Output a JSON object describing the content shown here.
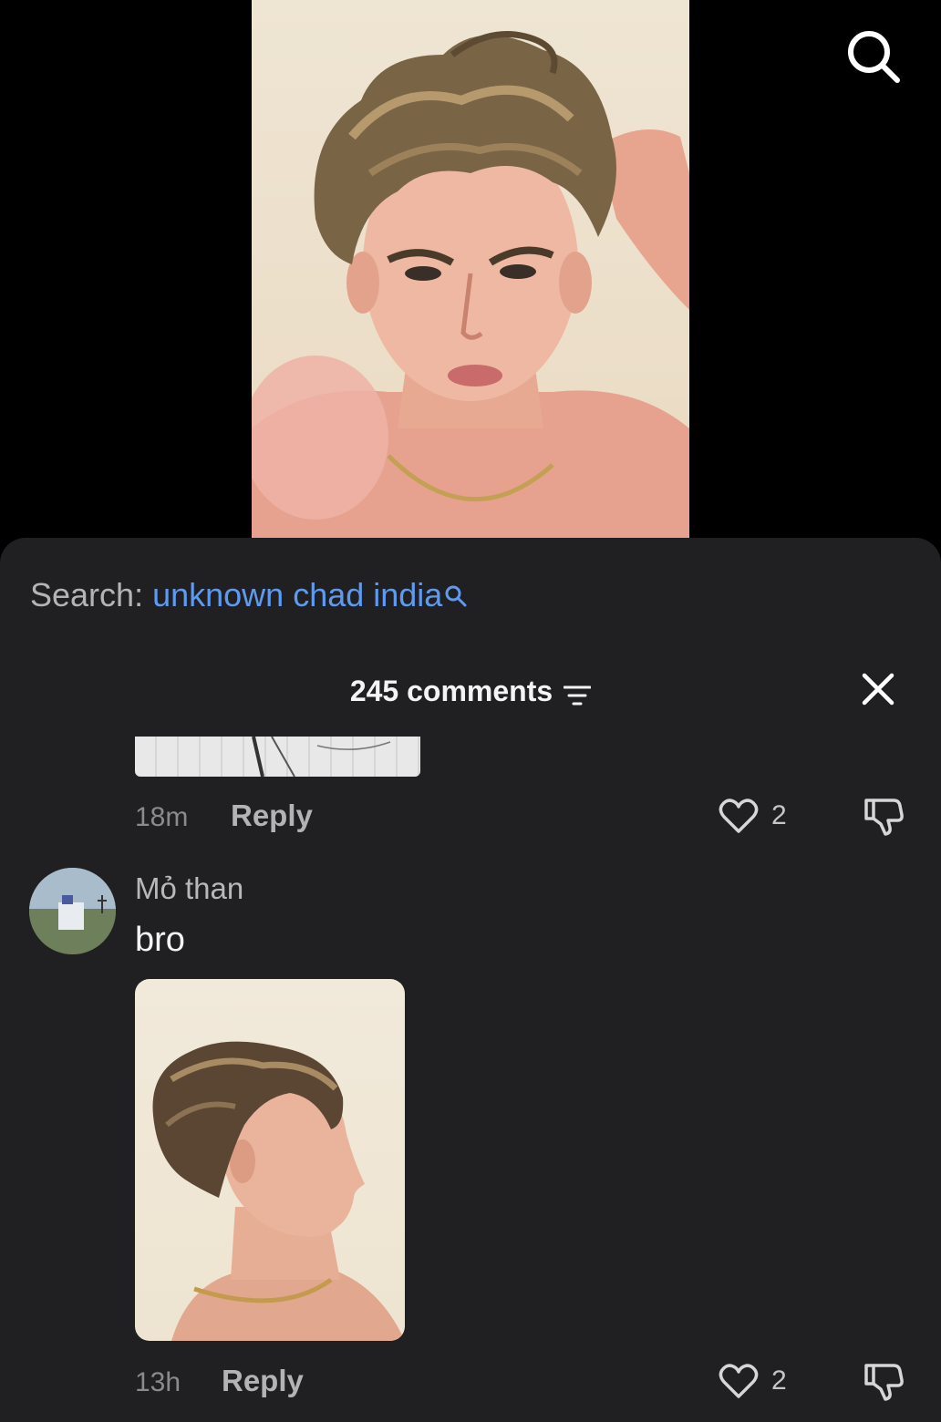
{
  "top_bar": {
    "search_icon": "search-icon"
  },
  "video": {
    "thumbnail_icon": "video-frame"
  },
  "sheet": {
    "search_prefix": "Search:",
    "search_query": "unknown chad india",
    "header": {
      "comments_count_label": "245 comments",
      "sort_icon": "filter-lines-icon",
      "close_icon": "close-icon"
    },
    "comments": [
      {
        "has_image": true,
        "time": "18m",
        "reply_label": "Reply",
        "likes": "2"
      },
      {
        "username": "Mỏ than",
        "text": "bro",
        "has_image": true,
        "time": "13h",
        "reply_label": "Reply",
        "likes": "2"
      }
    ]
  },
  "colors": {
    "sheet_bg": "#202022",
    "link_blue": "#5e9bf0",
    "muted_text": "#8b8b8e"
  }
}
